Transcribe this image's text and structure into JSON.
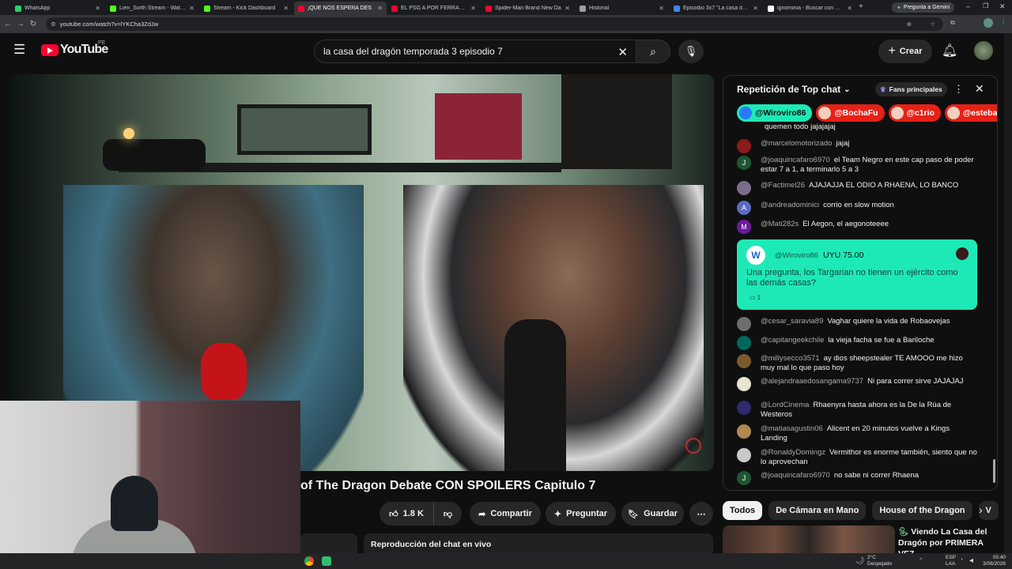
{
  "browser": {
    "tabs": [
      {
        "label": "WhatsApp",
        "color": "#25d366",
        "active": false
      },
      {
        "label": "Lien_Sorth Stream - Watch Live",
        "color": "#53fc18",
        "active": false
      },
      {
        "label": "Stream - Kick Dashboard",
        "color": "#53fc18",
        "active": false
      },
      {
        "label": "¡QUE NOS ESPERA DES",
        "color": "#ff0033",
        "active": true
      },
      {
        "label": "EL PSG A POR FERRAN TO",
        "color": "#ff0033",
        "active": false
      },
      {
        "label": "Spider-Man Brand New Da",
        "color": "#ff0033",
        "active": false
      },
      {
        "label": "Historial",
        "color": "#9aa0a6",
        "active": false
      },
      {
        "label": "Episodio 3x7 \"La casa del d",
        "color": "#4285f4",
        "active": false
      },
      {
        "label": "ignominia - Buscar con Google",
        "color": "#ffffff",
        "active": false
      }
    ],
    "gemini_label": "Pregunta a Gemini",
    "url": "youtube.com/watch?v=lYKCha3ZdJw"
  },
  "header": {
    "logo_text": "YouTube",
    "country_code": "PE",
    "search_value": "la casa del dragón temporada 3 episodio 7",
    "create_label": "Crear"
  },
  "video": {
    "title": "of The Dragon Debate CON SPOILERS Capitulo 7",
    "like_count": "1.8 K",
    "share_label": "Compartir",
    "ask_label": "Preguntar",
    "save_label": "Guardar",
    "chat_replay_label": "Reproducción del chat en vivo"
  },
  "chat": {
    "title": "Repetición de Top chat",
    "fans_label": "Fans principales",
    "top_chips": [
      {
        "name": "@Wiroviro86",
        "bg": "#1de9b6",
        "fg": "#0f0f0f"
      },
      {
        "name": "@BochaFu",
        "bg": "#e62117",
        "fg": "#ffffff"
      },
      {
        "name": "@c1rio",
        "bg": "#e62117",
        "fg": "#ffffff"
      },
      {
        "name": "@esteban",
        "bg": "#e62117",
        "fg": "#ffffff"
      }
    ],
    "messages": [
      {
        "author": "",
        "text": "quemen todo jajajajaj",
        "avatar": "",
        "color": "#0f0f0f"
      },
      {
        "author": "@marcelomotorizado",
        "text": "jajaj",
        "avatar": "",
        "color": "#8b1a1a"
      },
      {
        "author": "@joaquincafaro6970",
        "text": "el Team Negro en este cap paso de poder estar 7 a 1, a terminarlo 5 a 3",
        "avatar": "J",
        "color": "#1e5631"
      },
      {
        "author": "@Factimel26",
        "text": "AJAJAJJA EL ODIO A RHAENA, LO BANCO",
        "avatar": "",
        "color": "#7a6d8a"
      },
      {
        "author": "@andreadominici",
        "text": "corrio en slow motion",
        "avatar": "A",
        "color": "#5c6bc0"
      },
      {
        "author": "@Mati282s",
        "text": "El Aegon, el aegonoteeee",
        "avatar": "M",
        "color": "#6a1b9a"
      },
      {
        "author": "@cesar_saravia89",
        "text": "Vaghar quiere la vida de Robaovejas",
        "avatar": "",
        "color": "#6d6d6d"
      },
      {
        "author": "@capitangeekchile",
        "text": "la vieja facha se fue a Bariloche",
        "avatar": "",
        "color": "#00695c"
      },
      {
        "author": "@millysecco3571",
        "text": "ay dios sheepstealer TE AMOOO me hizo muy mal lo que paso hoy",
        "avatar": "",
        "color": "#7c5a2c"
      },
      {
        "author": "@alejandraaedosangama9737",
        "text": "Ni para correr sirve JAJAJAJ",
        "avatar": "",
        "color": "#e8e4d0"
      },
      {
        "author": "@LordCinema",
        "text": "Rhaenyra hasta ahora es la De la Rúa de Westeros",
        "avatar": "",
        "color": "#2c2c6c"
      },
      {
        "author": "@matiasagustin06",
        "text": "Alicent en 20 minutos vuelve a Kings Landing",
        "avatar": "",
        "color": "#b08850"
      },
      {
        "author": "@RonaldyDomingz",
        "text": "Vermithor es enorme también, siento que no lo aprovechan",
        "avatar": "",
        "color": "#c9c9c9"
      },
      {
        "author": "@joaquincafaro6970",
        "text": "no sabe ni correr Rhaena",
        "avatar": "J",
        "color": "#1e5631"
      }
    ],
    "superchat": {
      "author": "@Wiroviro86",
      "avatar": "W",
      "amount": "UYU 75.00",
      "text": "Una pregunta, los Targarian no tienen un ejército como las demás casas?",
      "reply_count": "1",
      "color": "#1de9b6"
    }
  },
  "related": {
    "chips": [
      "Todos",
      "De Cámara en Mano",
      "House of the Dragon",
      "V"
    ],
    "item_title": "Viendo La Casa del Dragón por PRIMERA VEZ"
  },
  "taskbar": {
    "weather_temp": "2°C",
    "weather_desc": "Despejado",
    "lang_top": "ESP",
    "lang_bottom": "LAA",
    "time": "05:40",
    "date": "3/08/2026"
  }
}
